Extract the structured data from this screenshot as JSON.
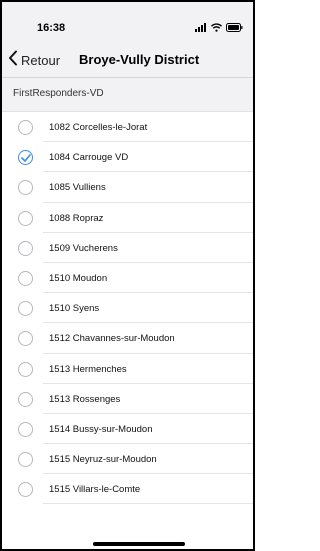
{
  "status_bar": {
    "time": "16:38",
    "icons": [
      "signal-icon",
      "wifi-icon",
      "battery-icon"
    ]
  },
  "nav": {
    "back_label": "Retour",
    "back_icon": "chevron-left-icon",
    "title": "Broye-Vully District"
  },
  "section": {
    "label": "FirstResponders-VD"
  },
  "colors": {
    "accent": "#3a8ee6",
    "header_bg": "#f2f2f4"
  },
  "list": {
    "items": [
      {
        "label": "1082 Corcelles-le-Jorat",
        "checked": false
      },
      {
        "label": "1084 Carrouge VD",
        "checked": true
      },
      {
        "label": "1085 Vulliens",
        "checked": false
      },
      {
        "label": "1088 Ropraz",
        "checked": false
      },
      {
        "label": "1509 Vucherens",
        "checked": false
      },
      {
        "label": "1510 Moudon",
        "checked": false
      },
      {
        "label": "1510 Syens",
        "checked": false
      },
      {
        "label": "1512 Chavannes-sur-Moudon",
        "checked": false
      },
      {
        "label": "1513 Hermenches",
        "checked": false
      },
      {
        "label": "1513 Rossenges",
        "checked": false
      },
      {
        "label": "1514 Bussy-sur-Moudon",
        "checked": false
      },
      {
        "label": "1515 Neyruz-sur-Moudon",
        "checked": false
      },
      {
        "label": "1515 Villars-le-Comte",
        "checked": false
      }
    ]
  }
}
